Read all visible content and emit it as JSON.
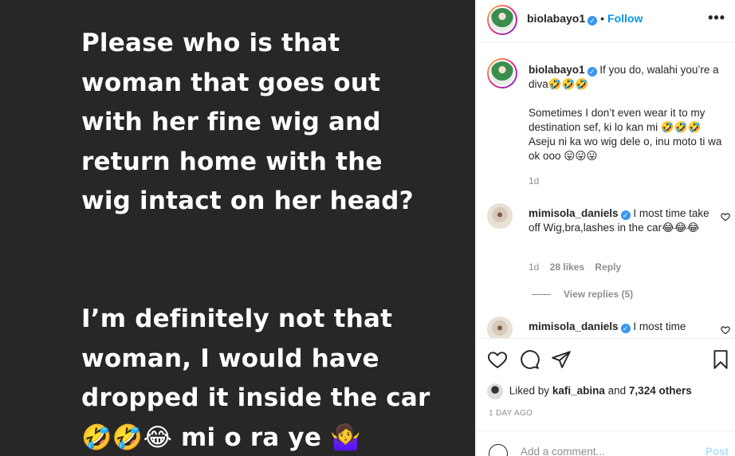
{
  "post": {
    "text_one": "Please who is that\nwoman that goes out\nwith her fine wig and\nreturn home with the\nwig intact on her head?",
    "text_two": "I’m definitely not that\nwoman, I would have\ndropped it inside the car\n🤣🤣😂 mi o ra ye 🤷‍♀️"
  },
  "header": {
    "username": "biolabayo1",
    "verified_glyph": "✓",
    "dot": "•",
    "follow_label": "Follow",
    "more_glyph": "•••"
  },
  "caption": {
    "username": "biolabayo1",
    "text_line1": "If you do, walahi you’re a diva🤣🤣🤣",
    "text_line2": "Sometimes I don’t even wear it to my destination sef, ki lo kan mi 🤣🤣🤣 Aseju ni ka wo wig dele o, inu moto ti wa ok ooo 😛😛😛",
    "time": "1d"
  },
  "comments": [
    {
      "username": "mimisola_daniels",
      "text": "I most time take off Wig,bra,lashes in the car😂😂😂",
      "time": "1d",
      "likes": "28 likes",
      "reply_label": "Reply",
      "view_replies": "View replies (5)"
    },
    {
      "username": "mimisola_daniels",
      "text": "I most time"
    }
  ],
  "likes": {
    "prefix": "Liked by",
    "user": "kafi_abina",
    "middle": "and",
    "count": "7,324 others"
  },
  "date": "1 DAY AGO",
  "comment_box": {
    "placeholder": "Add a comment...",
    "post_label": "Post"
  },
  "icons": [
    "heart-icon",
    "comment-icon",
    "share-icon",
    "bookmark-icon",
    "emoji-icon",
    "more-icon"
  ]
}
